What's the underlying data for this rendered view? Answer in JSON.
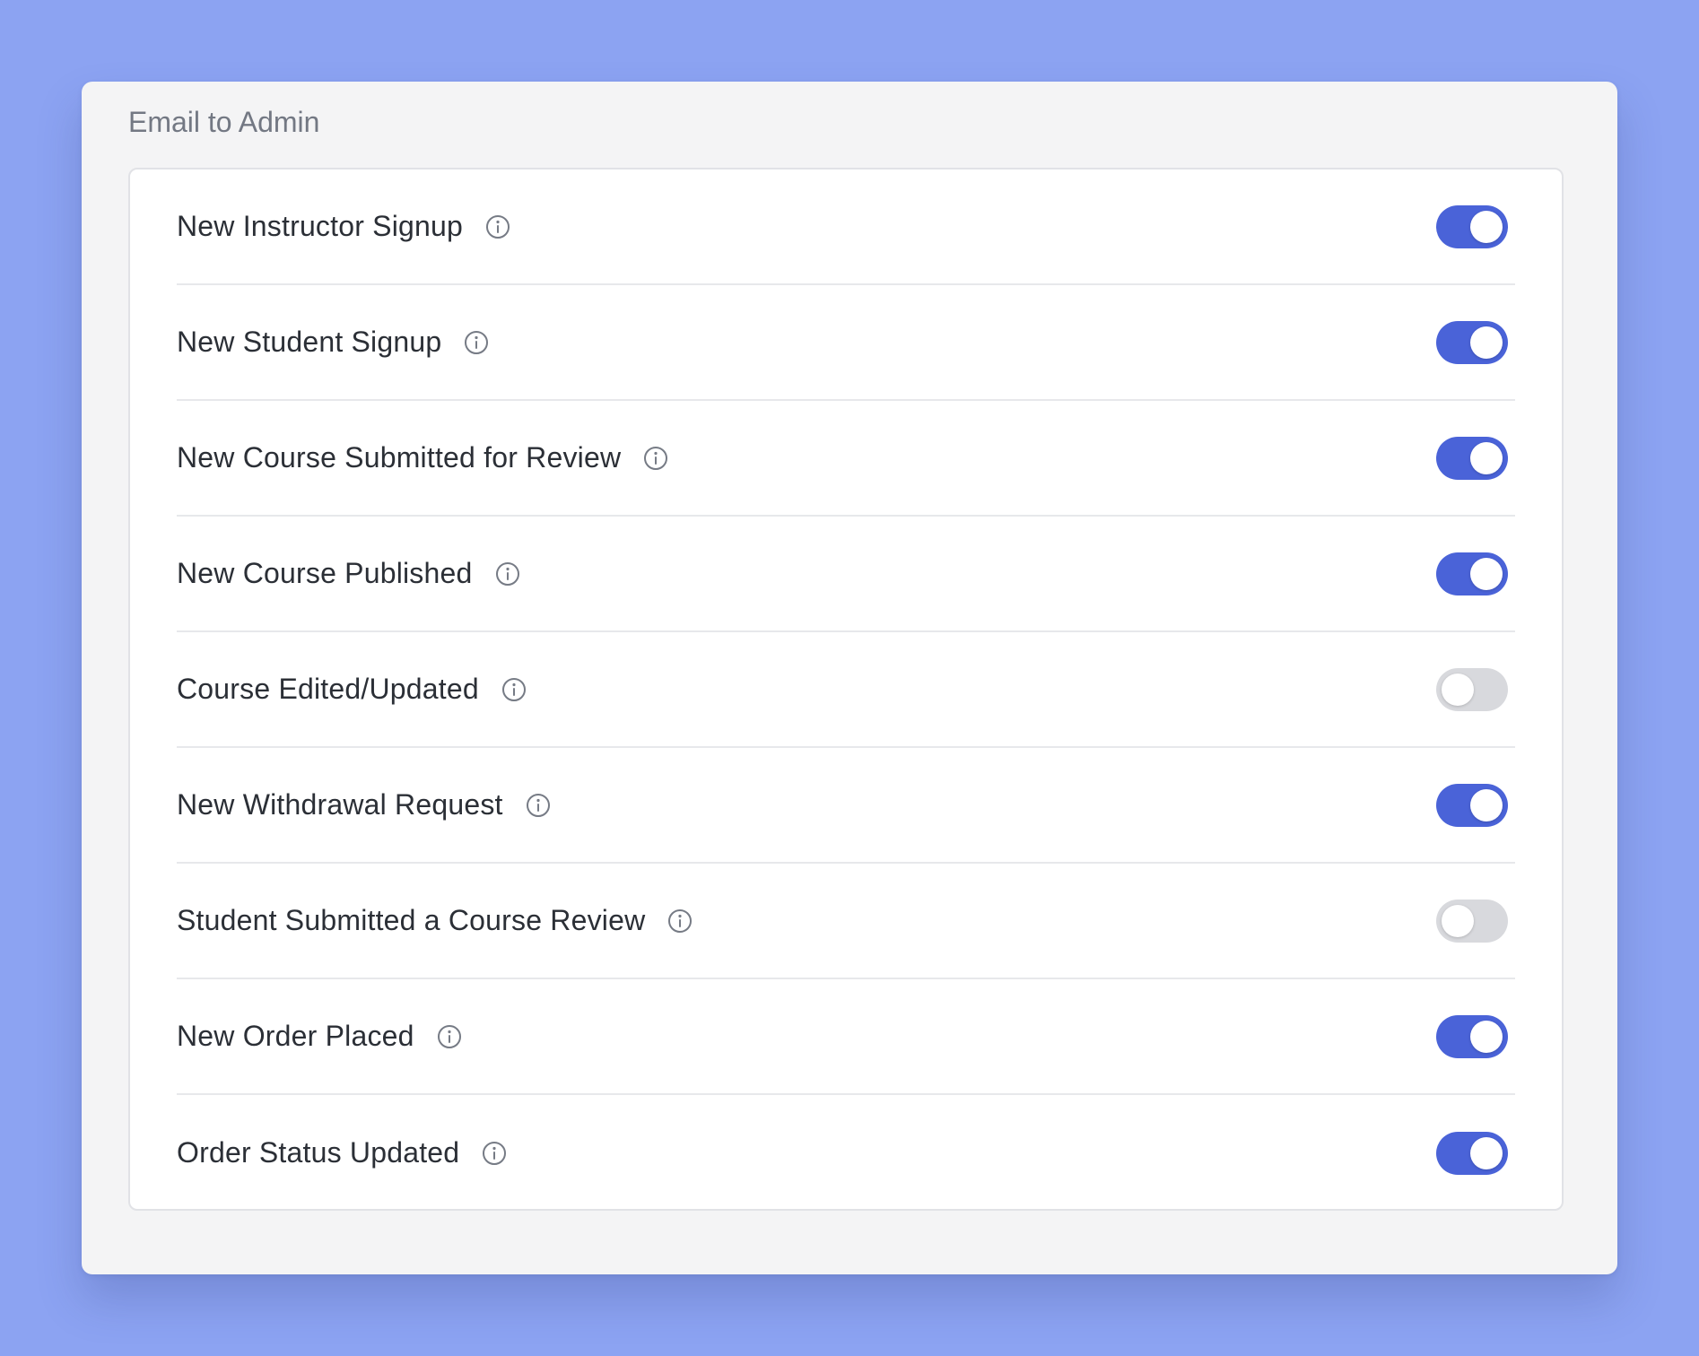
{
  "panel": {
    "title": "Email to Admin"
  },
  "colors": {
    "page_background": "#8ca3f2",
    "toggle_on": "#4a63d8",
    "toggle_off": "#d8d9dd"
  },
  "settings": [
    {
      "label": "New Instructor Signup",
      "enabled": true
    },
    {
      "label": "New Student Signup",
      "enabled": true
    },
    {
      "label": "New Course Submitted for Review",
      "enabled": true
    },
    {
      "label": "New Course Published",
      "enabled": true
    },
    {
      "label": "Course Edited/Updated",
      "enabled": false
    },
    {
      "label": "New Withdrawal Request",
      "enabled": true
    },
    {
      "label": "Student Submitted a Course Review",
      "enabled": false
    },
    {
      "label": "New Order Placed",
      "enabled": true
    },
    {
      "label": "Order Status Updated",
      "enabled": true
    }
  ],
  "icons": {
    "row_info": "info-circle-icon"
  }
}
